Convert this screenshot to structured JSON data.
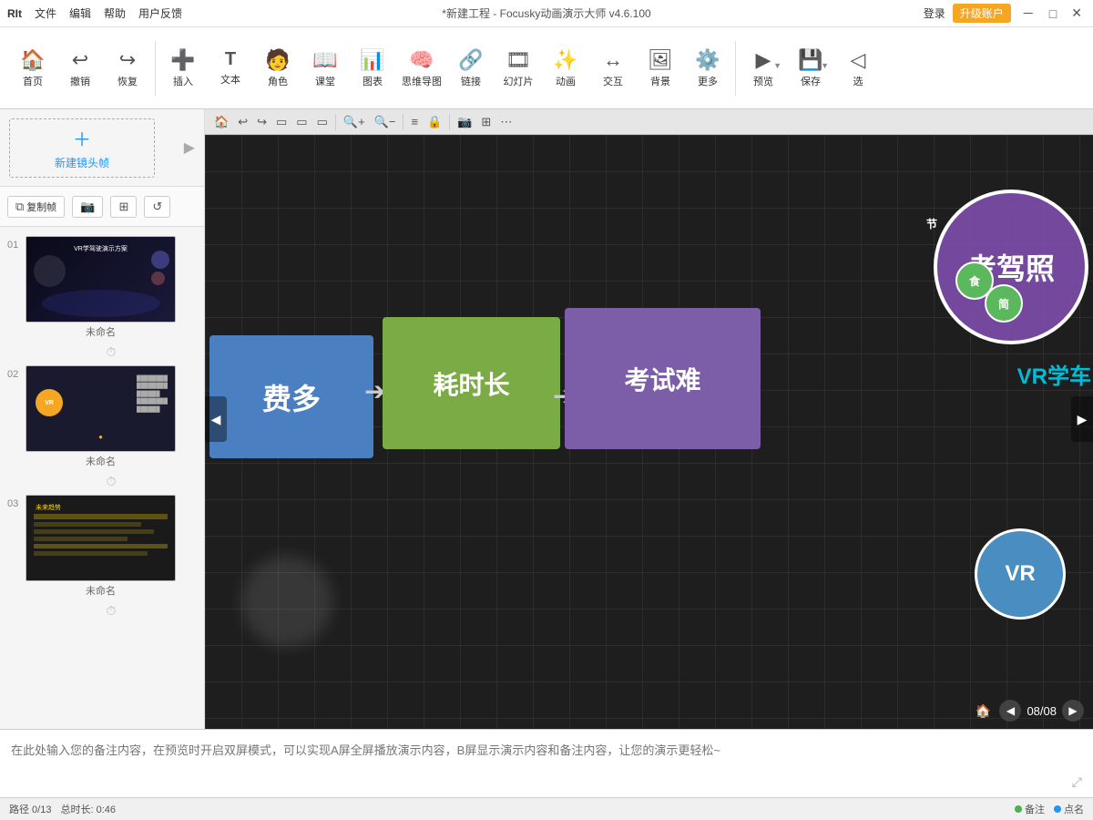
{
  "titlebar": {
    "menu": [
      "RIt",
      "文件",
      "编辑",
      "帮助",
      "用户反馈"
    ],
    "title": "*新建工程 - Focusky动画演示大师 v4.6.100",
    "login": "登录",
    "upgrade": "升级账户",
    "min": "－",
    "max": "□",
    "close": "✕"
  },
  "toolbar": {
    "items": [
      {
        "icon": "🏠",
        "label": "首页"
      },
      {
        "icon": "↩",
        "label": "撤销"
      },
      {
        "icon": "↪",
        "label": "恢复"
      },
      {
        "icon": "sep"
      },
      {
        "icon": "＋",
        "label": "插入"
      },
      {
        "icon": "T",
        "label": "文本"
      },
      {
        "icon": "👤",
        "label": "角色"
      },
      {
        "icon": "📚",
        "label": "课堂"
      },
      {
        "icon": "📊",
        "label": "图表"
      },
      {
        "icon": "🧠",
        "label": "思维导图"
      },
      {
        "icon": "🔗",
        "label": "链接"
      },
      {
        "icon": "🎞",
        "label": "幻灯片"
      },
      {
        "icon": "🎬",
        "label": "动画"
      },
      {
        "icon": "↔",
        "label": "交互"
      },
      {
        "icon": "🖼",
        "label": "背景"
      },
      {
        "icon": "⋯",
        "label": "更多"
      },
      {
        "icon": "sep"
      },
      {
        "icon": "▶",
        "label": "预览"
      },
      {
        "icon": "💾",
        "label": "保存"
      },
      {
        "icon": "◀",
        "label": "选"
      }
    ]
  },
  "sidebar": {
    "new_frame_label": "新建镜头帧",
    "actions": [
      "复制帧",
      "📷",
      "⊞",
      "↺"
    ],
    "slides": [
      {
        "num": "01",
        "label": "未命名",
        "selected": false
      },
      {
        "num": "02",
        "label": "未命名",
        "selected": false
      },
      {
        "num": "03",
        "label": "未命名",
        "selected": false
      }
    ]
  },
  "canvas": {
    "nav": {
      "home": "🏠",
      "icons": [
        "↩",
        "↪",
        "□",
        "□",
        "□",
        "□",
        "🔍",
        "🔍",
        "□",
        "□",
        "□",
        "□",
        "□",
        "□",
        "□",
        "□",
        "□"
      ]
    },
    "elements": {
      "box1": "费多",
      "box2": "耗时长",
      "box3": "考试难",
      "circle_main": "考驾照",
      "mini1": "食",
      "mini2": "简",
      "mini3": "节",
      "vr_circle": "VR",
      "vr_text": "VR学车"
    },
    "page_current": "08",
    "page_total": "08"
  },
  "notes": {
    "placeholder": "在此处输入您的备注内容，在预览时开启双屏模式，可以实现A屏全屏播放演示内容，B屏显示演示内容和备注内容，让您的演示更轻松~"
  },
  "statusbar": {
    "path": "路径 0/13",
    "duration": "总时长: 0:46",
    "note_btn": "备注",
    "point_btn": "点名"
  }
}
